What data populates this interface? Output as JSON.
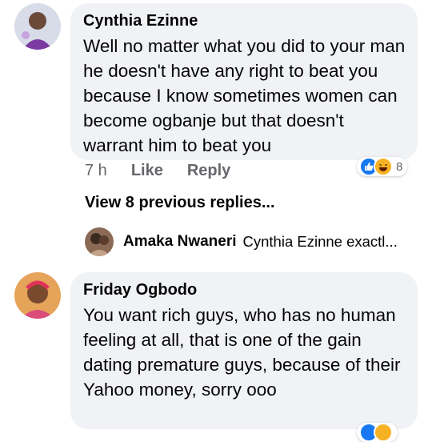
{
  "comments": [
    {
      "author": "Cynthia Ezinne",
      "text": "Well no matter what you did to your man he doesn't have any right to beat you because I know sometimes women can become ogbanje but that doesn't warrant him to beat you",
      "time": "7 h",
      "like_label": "Like",
      "reply_label": "Reply",
      "reaction_icons": [
        "like-icon",
        "haha-icon"
      ],
      "reaction_count": "8"
    },
    {
      "author": "Friday Ogbodo",
      "text": "You want rich guys, who has no human feeling at all, that is one of the gain dating premature guys, because of their Yahoo money, sorry ooo"
    }
  ],
  "replies_section": {
    "view_more_label": "View 8 previous replies...",
    "latest_reply": {
      "author": "Amaka Nwaneri",
      "snippet": "Cynthia Ezinne exactl..."
    }
  },
  "colors": {
    "bubble": "#f0f2f5",
    "meta_text": "#65676b",
    "like_blue": "#1877f2",
    "haha_yellow": "#f7b125"
  }
}
